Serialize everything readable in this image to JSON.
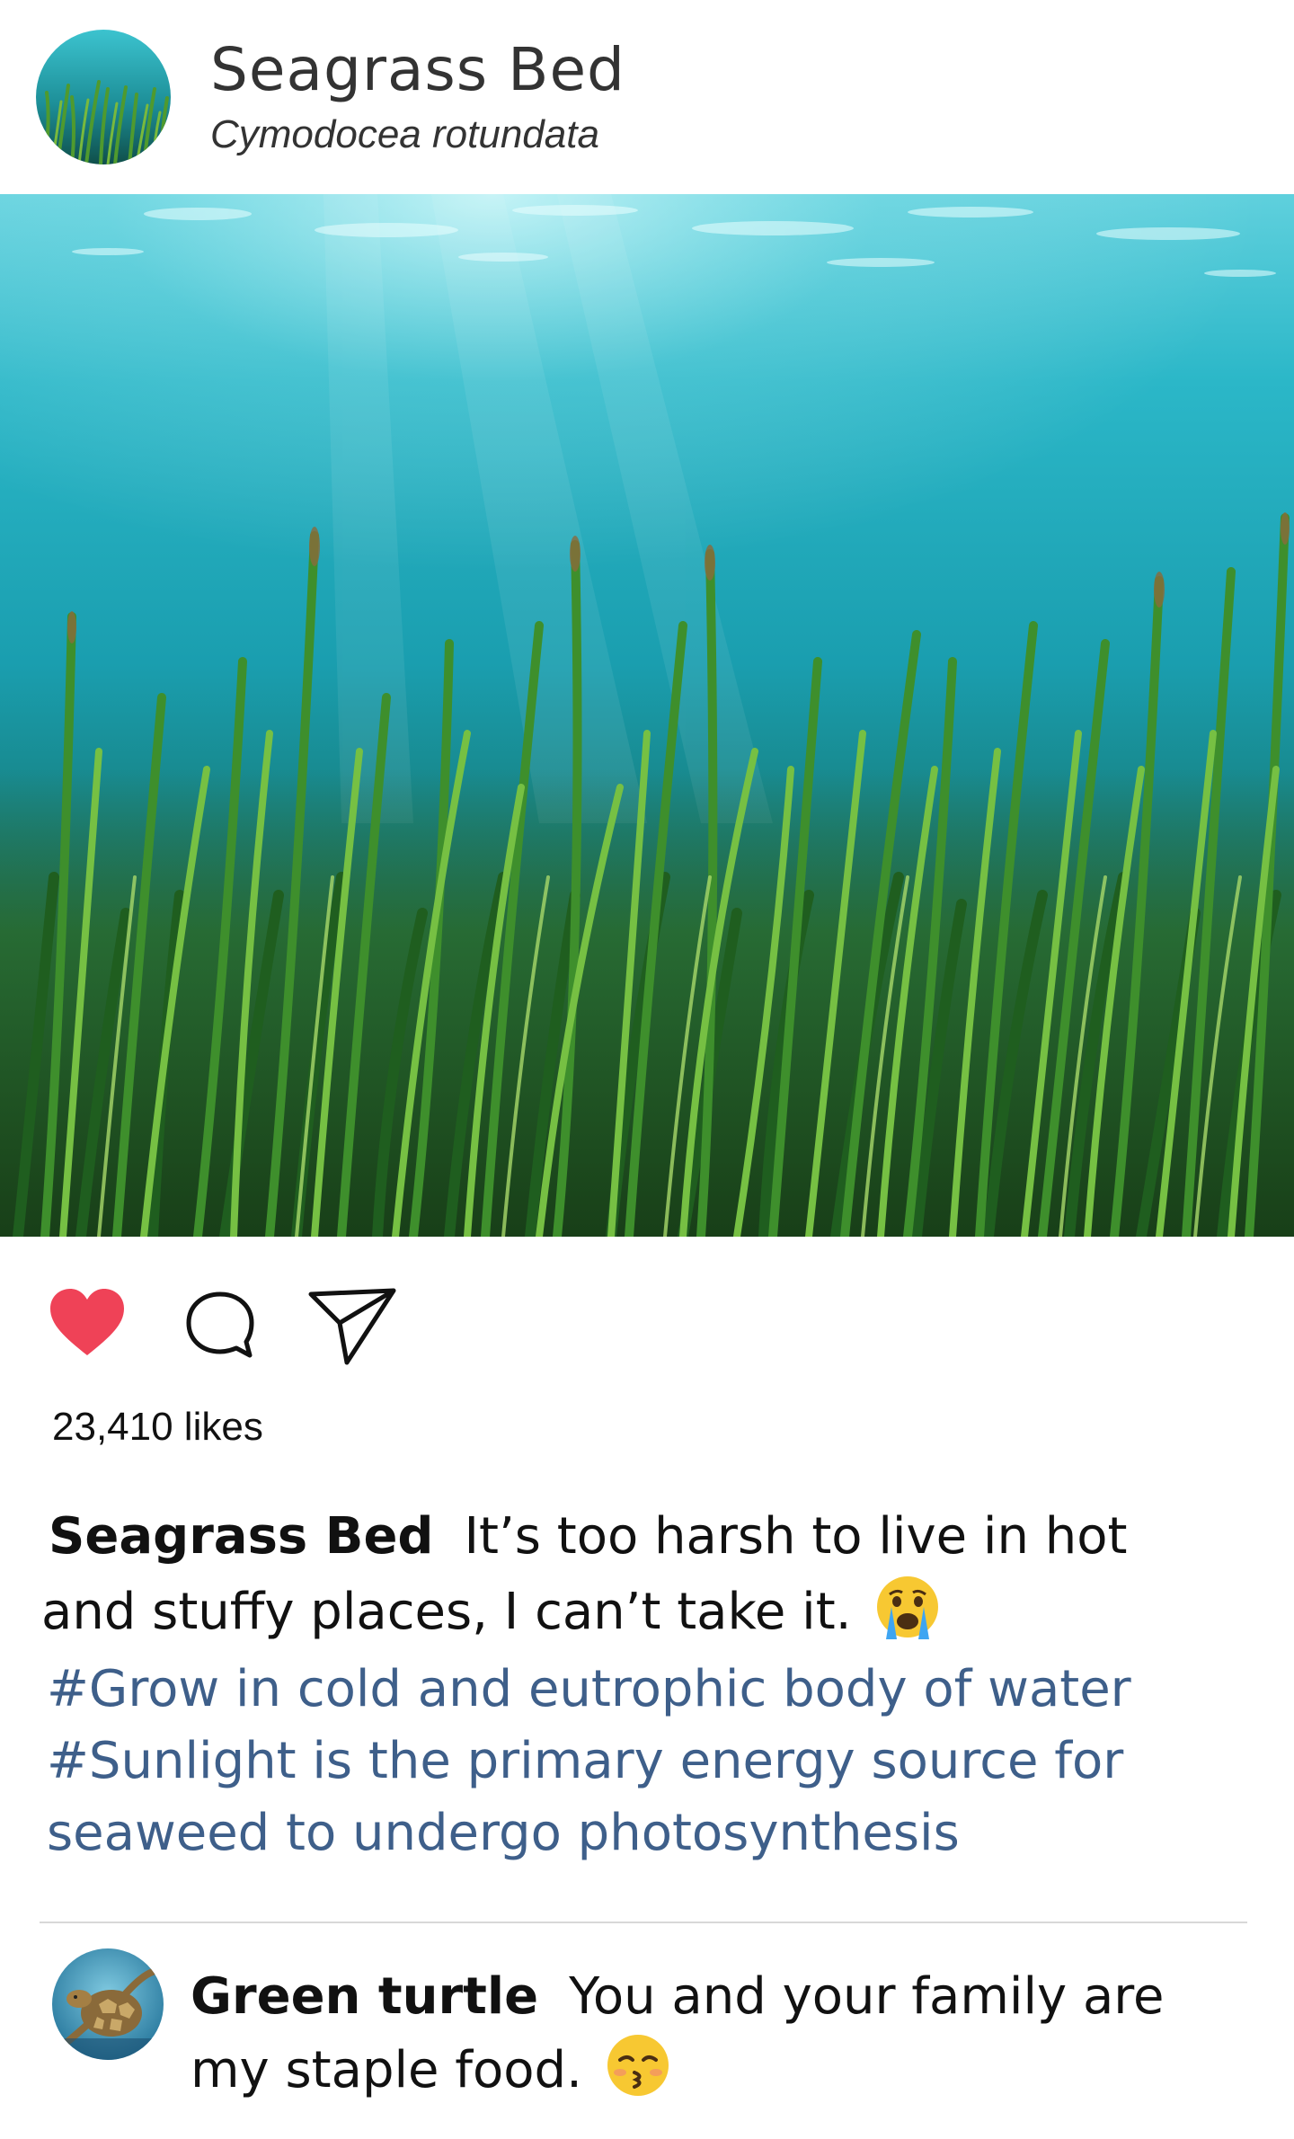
{
  "post": {
    "account_name": "Seagrass Bed",
    "account_subtitle": "Cymodocea rotundata",
    "likes_text": "23,410 likes",
    "caption_user": "Seagrass Bed",
    "caption_text": "It’s too harsh to live in hot and stuffy places, I can’t take it.",
    "caption_emoji": "crying-face-emoji",
    "hashtags": [
      "#Grow in cold and eutrophic body of water",
      "#Sunlight is the primary energy source for",
      "seaweed to undergo photosynthesis"
    ],
    "liked": true
  },
  "comment": {
    "user": "Green turtle",
    "text": "You and your family are my staple food.",
    "emoji": "kissing-face-emoji"
  },
  "colors": {
    "heart": "#ef4257",
    "hashtag": "#3e5f8a",
    "water_top": "#38b6c4",
    "grass": "#2f7a23"
  },
  "icons": [
    "heart-icon",
    "comment-bubble-icon",
    "share-paper-plane-icon"
  ]
}
